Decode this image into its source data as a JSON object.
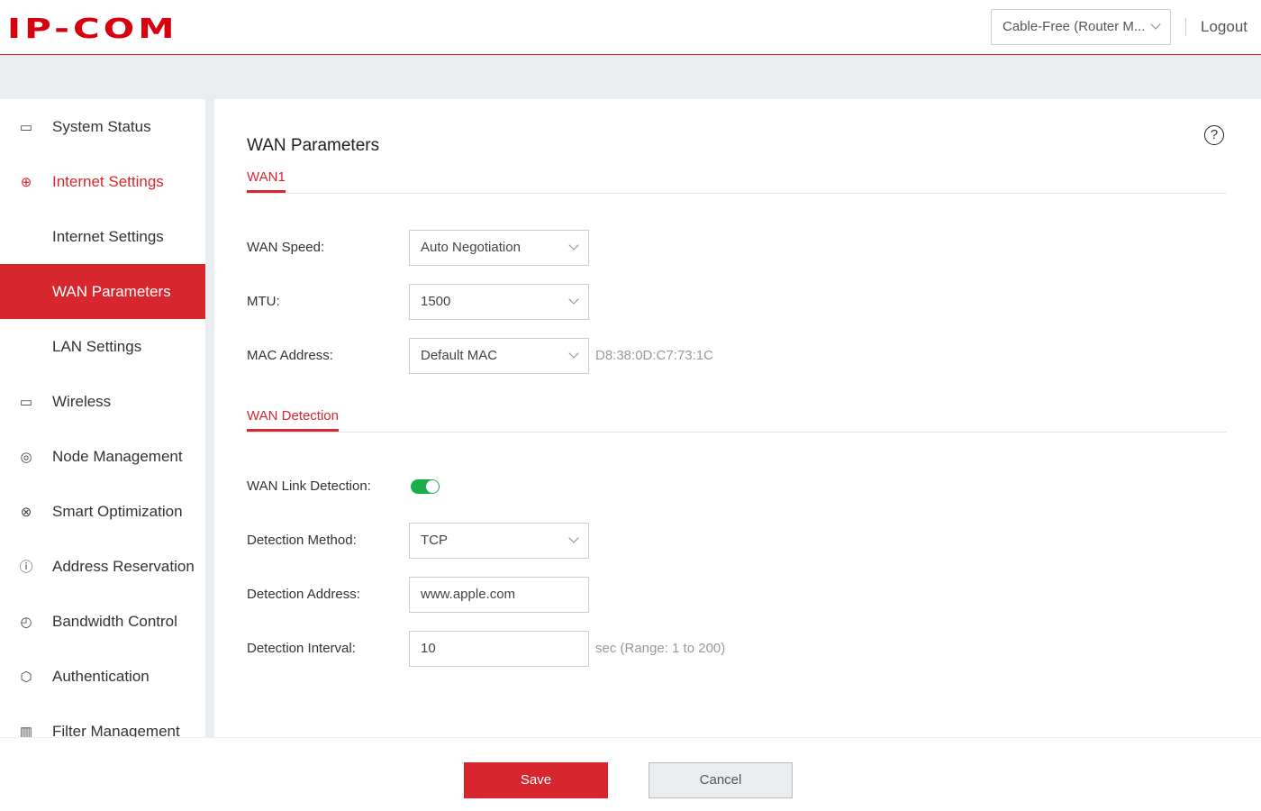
{
  "header": {
    "logo": "IP-COM",
    "mode": "Cable-Free (Router M...",
    "logout": "Logout"
  },
  "sidebar": {
    "items": [
      {
        "label": "System Status",
        "icon": "monitor-chart-icon"
      },
      {
        "label": "Internet Settings",
        "icon": "globe-icon"
      },
      {
        "label": "Internet Settings"
      },
      {
        "label": "WAN Parameters"
      },
      {
        "label": "LAN Settings"
      },
      {
        "label": "Wireless",
        "icon": "wifi-screen-icon"
      },
      {
        "label": "Node Management",
        "icon": "nodes-icon"
      },
      {
        "label": "Smart Optimization",
        "icon": "atom-icon"
      },
      {
        "label": "Address Reservation",
        "icon": "ip-icon"
      },
      {
        "label": "Bandwidth Control",
        "icon": "gauge-icon"
      },
      {
        "label": "Authentication",
        "icon": "shield-check-icon"
      },
      {
        "label": "Filter Management",
        "icon": "filter-chart-icon"
      }
    ]
  },
  "main": {
    "title": "WAN Parameters",
    "tab1": "WAN1",
    "tab2": "WAN Detection",
    "wan_speed": {
      "label": "WAN Speed:",
      "value": "Auto Negotiation"
    },
    "mtu": {
      "label": "MTU:",
      "value": "1500"
    },
    "mac": {
      "label": "MAC Address:",
      "value": "Default MAC",
      "hint": "D8:38:0D:C7:73:1C"
    },
    "link": {
      "label": "WAN Link Detection:",
      "enabled": true
    },
    "method": {
      "label": "Detection Method:",
      "value": "TCP"
    },
    "address": {
      "label": "Detection Address:",
      "value": "www.apple.com"
    },
    "interval": {
      "label": "Detection Interval:",
      "value": "10",
      "hint": "sec (Range: 1 to 200)"
    }
  },
  "footer": {
    "save": "Save",
    "cancel": "Cancel"
  }
}
